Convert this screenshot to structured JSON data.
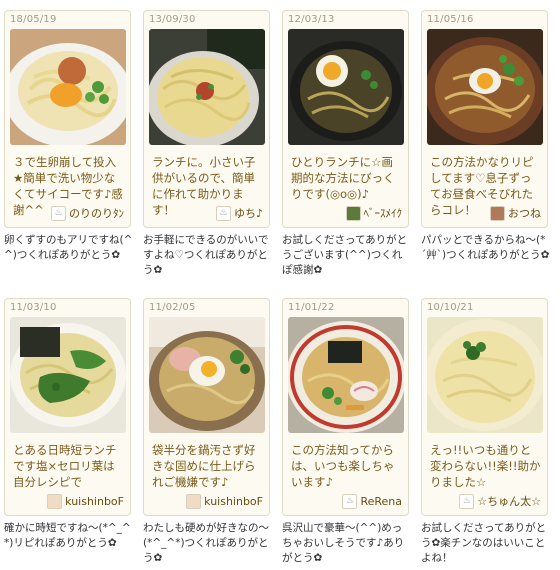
{
  "cards": [
    {
      "date": "18/05/19",
      "text": "３で生卵崩して投入★簡単で洗い物少なくてサイコーです♪感謝^^",
      "user": "のりのりﾀﾝ",
      "reply": "卵くずすのもアリですね(^^)つくれぽありがとう✿"
    },
    {
      "date": "13/09/30",
      "text": "ランチに。小さい子供がいるので、簡単に作れて助かります！",
      "user": "ゆち♪",
      "reply": "お手軽にできるのがいいですよね♡つくれぽありがとう✿"
    },
    {
      "date": "12/03/13",
      "text": "ひとりランチに☆画期的な方法にびっくりです(◎o◎)♪",
      "user": "ﾍﾞｰｽﾒｲｸ",
      "reply": "お試しくださってありがとうございます(^^)つくれぽ感謝✿"
    },
    {
      "date": "11/05/16",
      "text": "この方法かなりリピしてます♡息子ずってお昼食べそびれたらコレ！",
      "user": "おつね",
      "reply": "パパッとできるからね〜(*´艸`)つくれぽありがとう✿"
    },
    {
      "date": "11/03/10",
      "text": "とある日時短ランチです塩×セロリ葉は自分レシピで",
      "user": "kuishinboF",
      "reply": "確かに時短ですね〜(*^_^*)リピれぽありがとう✿"
    },
    {
      "date": "11/02/05",
      "text": "袋半分を鍋汚さず好きな固めに仕上げられご機嫌です♪",
      "user": "kuishinboF",
      "reply": "わたしも硬めが好きなの〜(*^_^*)つくれぽありがとう✿"
    },
    {
      "date": "11/01/22",
      "text": "この方法知ってからは、いつも楽しちゃいます♪",
      "user": "ReRena",
      "reply": "呉沢山で豪華〜(^^)めっちゃおいしそうです♪ありがとう✿"
    },
    {
      "date": "10/10/21",
      "text": "えっ!!いつも通りと変わらない!!楽!!助かりました☆",
      "user": "☆ちゅん太☆",
      "reply": "お試しくださってありがとう✿楽チンなのはいいことよね！"
    }
  ]
}
